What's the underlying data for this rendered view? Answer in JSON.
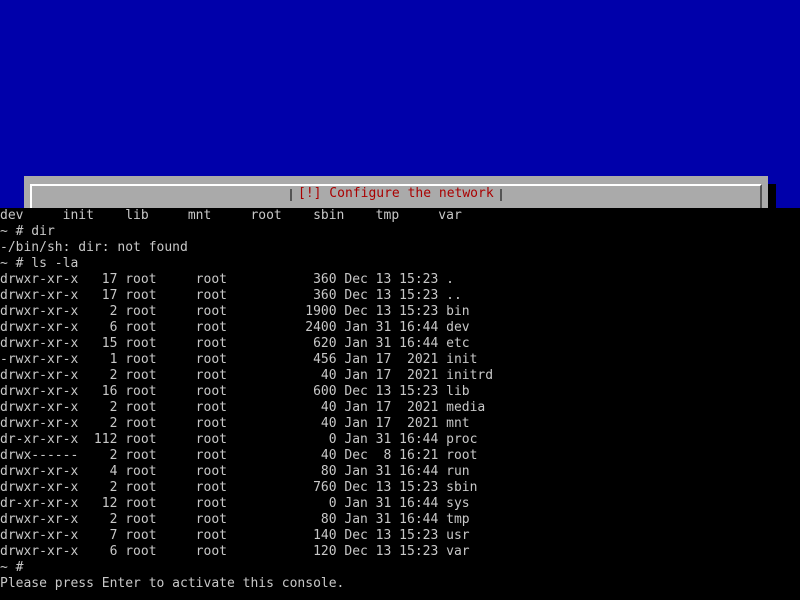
{
  "installer": {
    "title": "[!] Configure the network"
  },
  "console": {
    "lines": [
      "dev     init    lib     mnt     root    sbin    tmp     var",
      "~ # dir",
      "-/bin/sh: dir: not found",
      "~ # ls -la",
      "drwxr-xr-x   17 root     root           360 Dec 13 15:23 .",
      "drwxr-xr-x   17 root     root           360 Dec 13 15:23 ..",
      "drwxr-xr-x    2 root     root          1900 Dec 13 15:23 bin",
      "drwxr-xr-x    6 root     root          2400 Jan 31 16:44 dev",
      "drwxr-xr-x   15 root     root           620 Jan 31 16:44 etc",
      "-rwxr-xr-x    1 root     root           456 Jan 17  2021 init",
      "drwxr-xr-x    2 root     root            40 Jan 17  2021 initrd",
      "drwxr-xr-x   16 root     root           600 Dec 13 15:23 lib",
      "drwxr-xr-x    2 root     root            40 Jan 17  2021 media",
      "drwxr-xr-x    2 root     root            40 Jan 17  2021 mnt",
      "dr-xr-xr-x  112 root     root             0 Jan 31 16:44 proc",
      "drwx------    2 root     root            40 Dec  8 16:21 root",
      "drwxr-xr-x    4 root     root            80 Jan 31 16:44 run",
      "drwxr-xr-x    2 root     root           760 Dec 13 15:23 sbin",
      "dr-xr-xr-x   12 root     root             0 Jan 31 16:44 sys",
      "drwxr-xr-x    2 root     root            80 Jan 31 16:44 tmp",
      "drwxr-xr-x    7 root     root           140 Dec 13 15:23 usr",
      "drwxr-xr-x    6 root     root           120 Dec 13 15:23 var",
      "~ #",
      "Please press Enter to activate this console."
    ]
  }
}
